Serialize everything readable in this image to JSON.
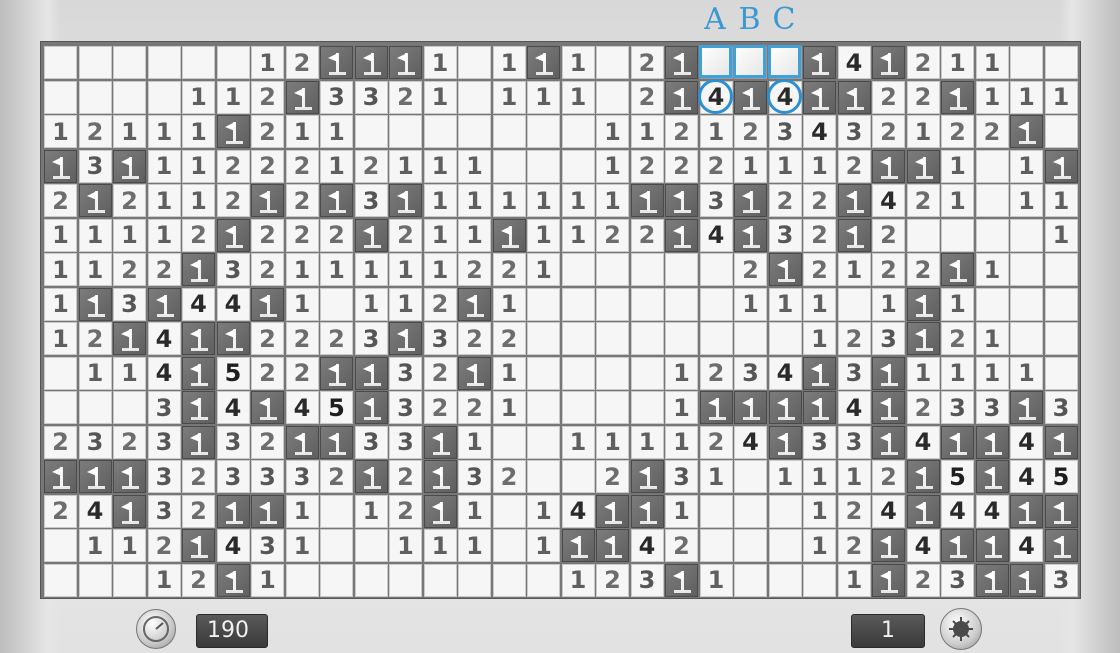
{
  "game": "Minesweeper",
  "board": {
    "cols": 30,
    "rows": 16,
    "legend": "Each row string: '.' = revealed empty, '#' = covered, 'F' = flagged, digit = revealed number",
    "cells": [
      "......12FFF1.1F1.2F###F4F211..",
      "....112F3321.111.2F4F4FF22F111",
      "12111F211.......112123432122F",
      "F3F1122212111...12221112FF1.1F2",
      "2F2112F2F3F111111FF3F22F421.111",
      "11112F222F211F1122F4F32F2....11",
      "1122F3211111221.....2F2122F1....1F",
      "1F3F44F1.112F1......111.1F1...11",
      "12F4FF2223F322........123F21...",
      ".114F522FF32F1....1234F3F1111.",
      "...3F4F45F3221....1FFFF4F233F31",
      "2323F32FF33F1..111124F33F4FF4F",
      "FFF323332F2F32..2F31.1112F5F45F",
      "24F32FF1.12F1.14FF1...124F44FF",
      ".112F431..111.1FF42...12F4FF4F4",
      "...12F1........123F1...1F23FF32F"
    ]
  },
  "column_labels": [
    "A",
    "B",
    "C"
  ],
  "annotations": {
    "highlighted_cells": [
      [
        0,
        19
      ],
      [
        0,
        20
      ],
      [
        0,
        21
      ]
    ],
    "circled_cells": [
      [
        1,
        19
      ],
      [
        1,
        21
      ]
    ]
  },
  "timer": {
    "value": "190",
    "icon": "stopwatch-icon"
  },
  "mines_left": {
    "value": "1",
    "icon": "mine-icon"
  }
}
